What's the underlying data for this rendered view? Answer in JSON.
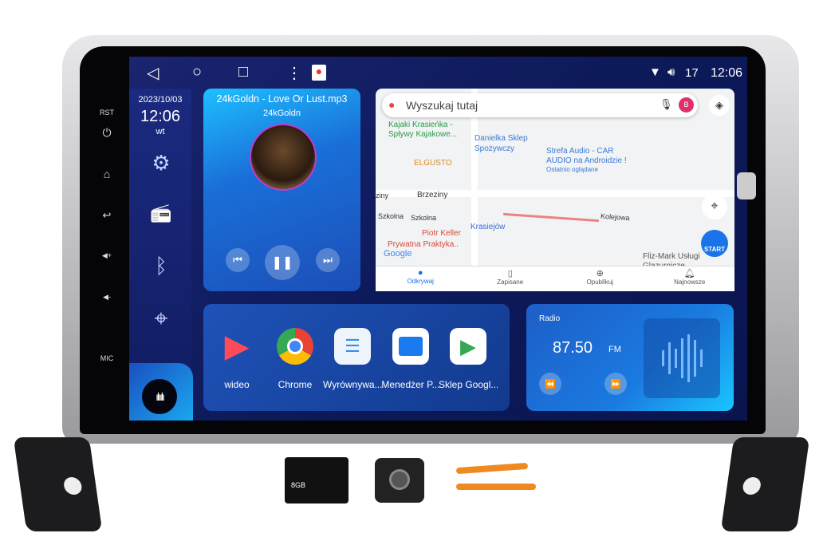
{
  "hardware_buttons": [
    "RST",
    "⏻",
    "⌂",
    "↩",
    "◀+",
    "◀-",
    "MIC"
  ],
  "status_bar": {
    "wifi_icon": "wifi-icon",
    "volume": "17",
    "time": "12:06"
  },
  "nav": {
    "back": "◁",
    "home": "○",
    "recents": "□",
    "menu": "⋮"
  },
  "sidebar": {
    "date": "2023/10/03",
    "time": "12:06",
    "day": "wt",
    "items": [
      {
        "icon": "gear-icon",
        "glyph": "⚙"
      },
      {
        "icon": "radio-icon",
        "glyph": "📻"
      },
      {
        "icon": "bluetooth-icon",
        "glyph": "ᛒ"
      },
      {
        "icon": "location-icon",
        "glyph": "⌖"
      }
    ]
  },
  "music": {
    "title": "24kGoldn - Love Or Lust.mp3",
    "artist": "24kGoldn",
    "prev": "⏮",
    "pause": "❚❚",
    "next": "⏭"
  },
  "map": {
    "search_placeholder": "Wyszukaj tutaj",
    "avatar": "B",
    "start": "START",
    "google": "Google",
    "labels": {
      "kajaki": "Kajaki Krasieńka -",
      "kajaki2": "Spływy Kajakowe...",
      "danielka": "Danielka Sklep",
      "danielka2": "Spożywczy",
      "strefa": "Strefa Audio - CAR",
      "strefa2": "AUDIO na Androidzie !",
      "strefa3": "Ostatnio oglądane",
      "elgusto": "ELGUSTO",
      "brzeziny": "Brzeziny",
      "brzeziny0": "ziny",
      "szkolna": "Szkolna",
      "szkolna2": "Szkolna",
      "piotr": "Piotr Keller",
      "piotr2": "Prywatna Praktyka..",
      "krasiejow": "Krasiejów",
      "kolejowa": "Kolejowa",
      "fliz": "Fliz-Mark Usługi",
      "fliz2": "Glazurnicze"
    },
    "tabs": [
      {
        "label": "Odkrywaj",
        "active": true
      },
      {
        "label": "Zapisane"
      },
      {
        "label": "Opublikuj"
      },
      {
        "label": "Najnowsze"
      }
    ]
  },
  "apps": [
    {
      "label": "wideo"
    },
    {
      "label": "Chrome"
    },
    {
      "label": "Wyrównywa..."
    },
    {
      "label": "Menedżer P..."
    },
    {
      "label": "Sklep Googl..."
    }
  ],
  "radio": {
    "title": "Radio",
    "frequency": "87.50",
    "band": "FM",
    "rewind": "⏪",
    "forward": "⏩"
  },
  "accessories": {
    "sd_card": "8GB"
  }
}
